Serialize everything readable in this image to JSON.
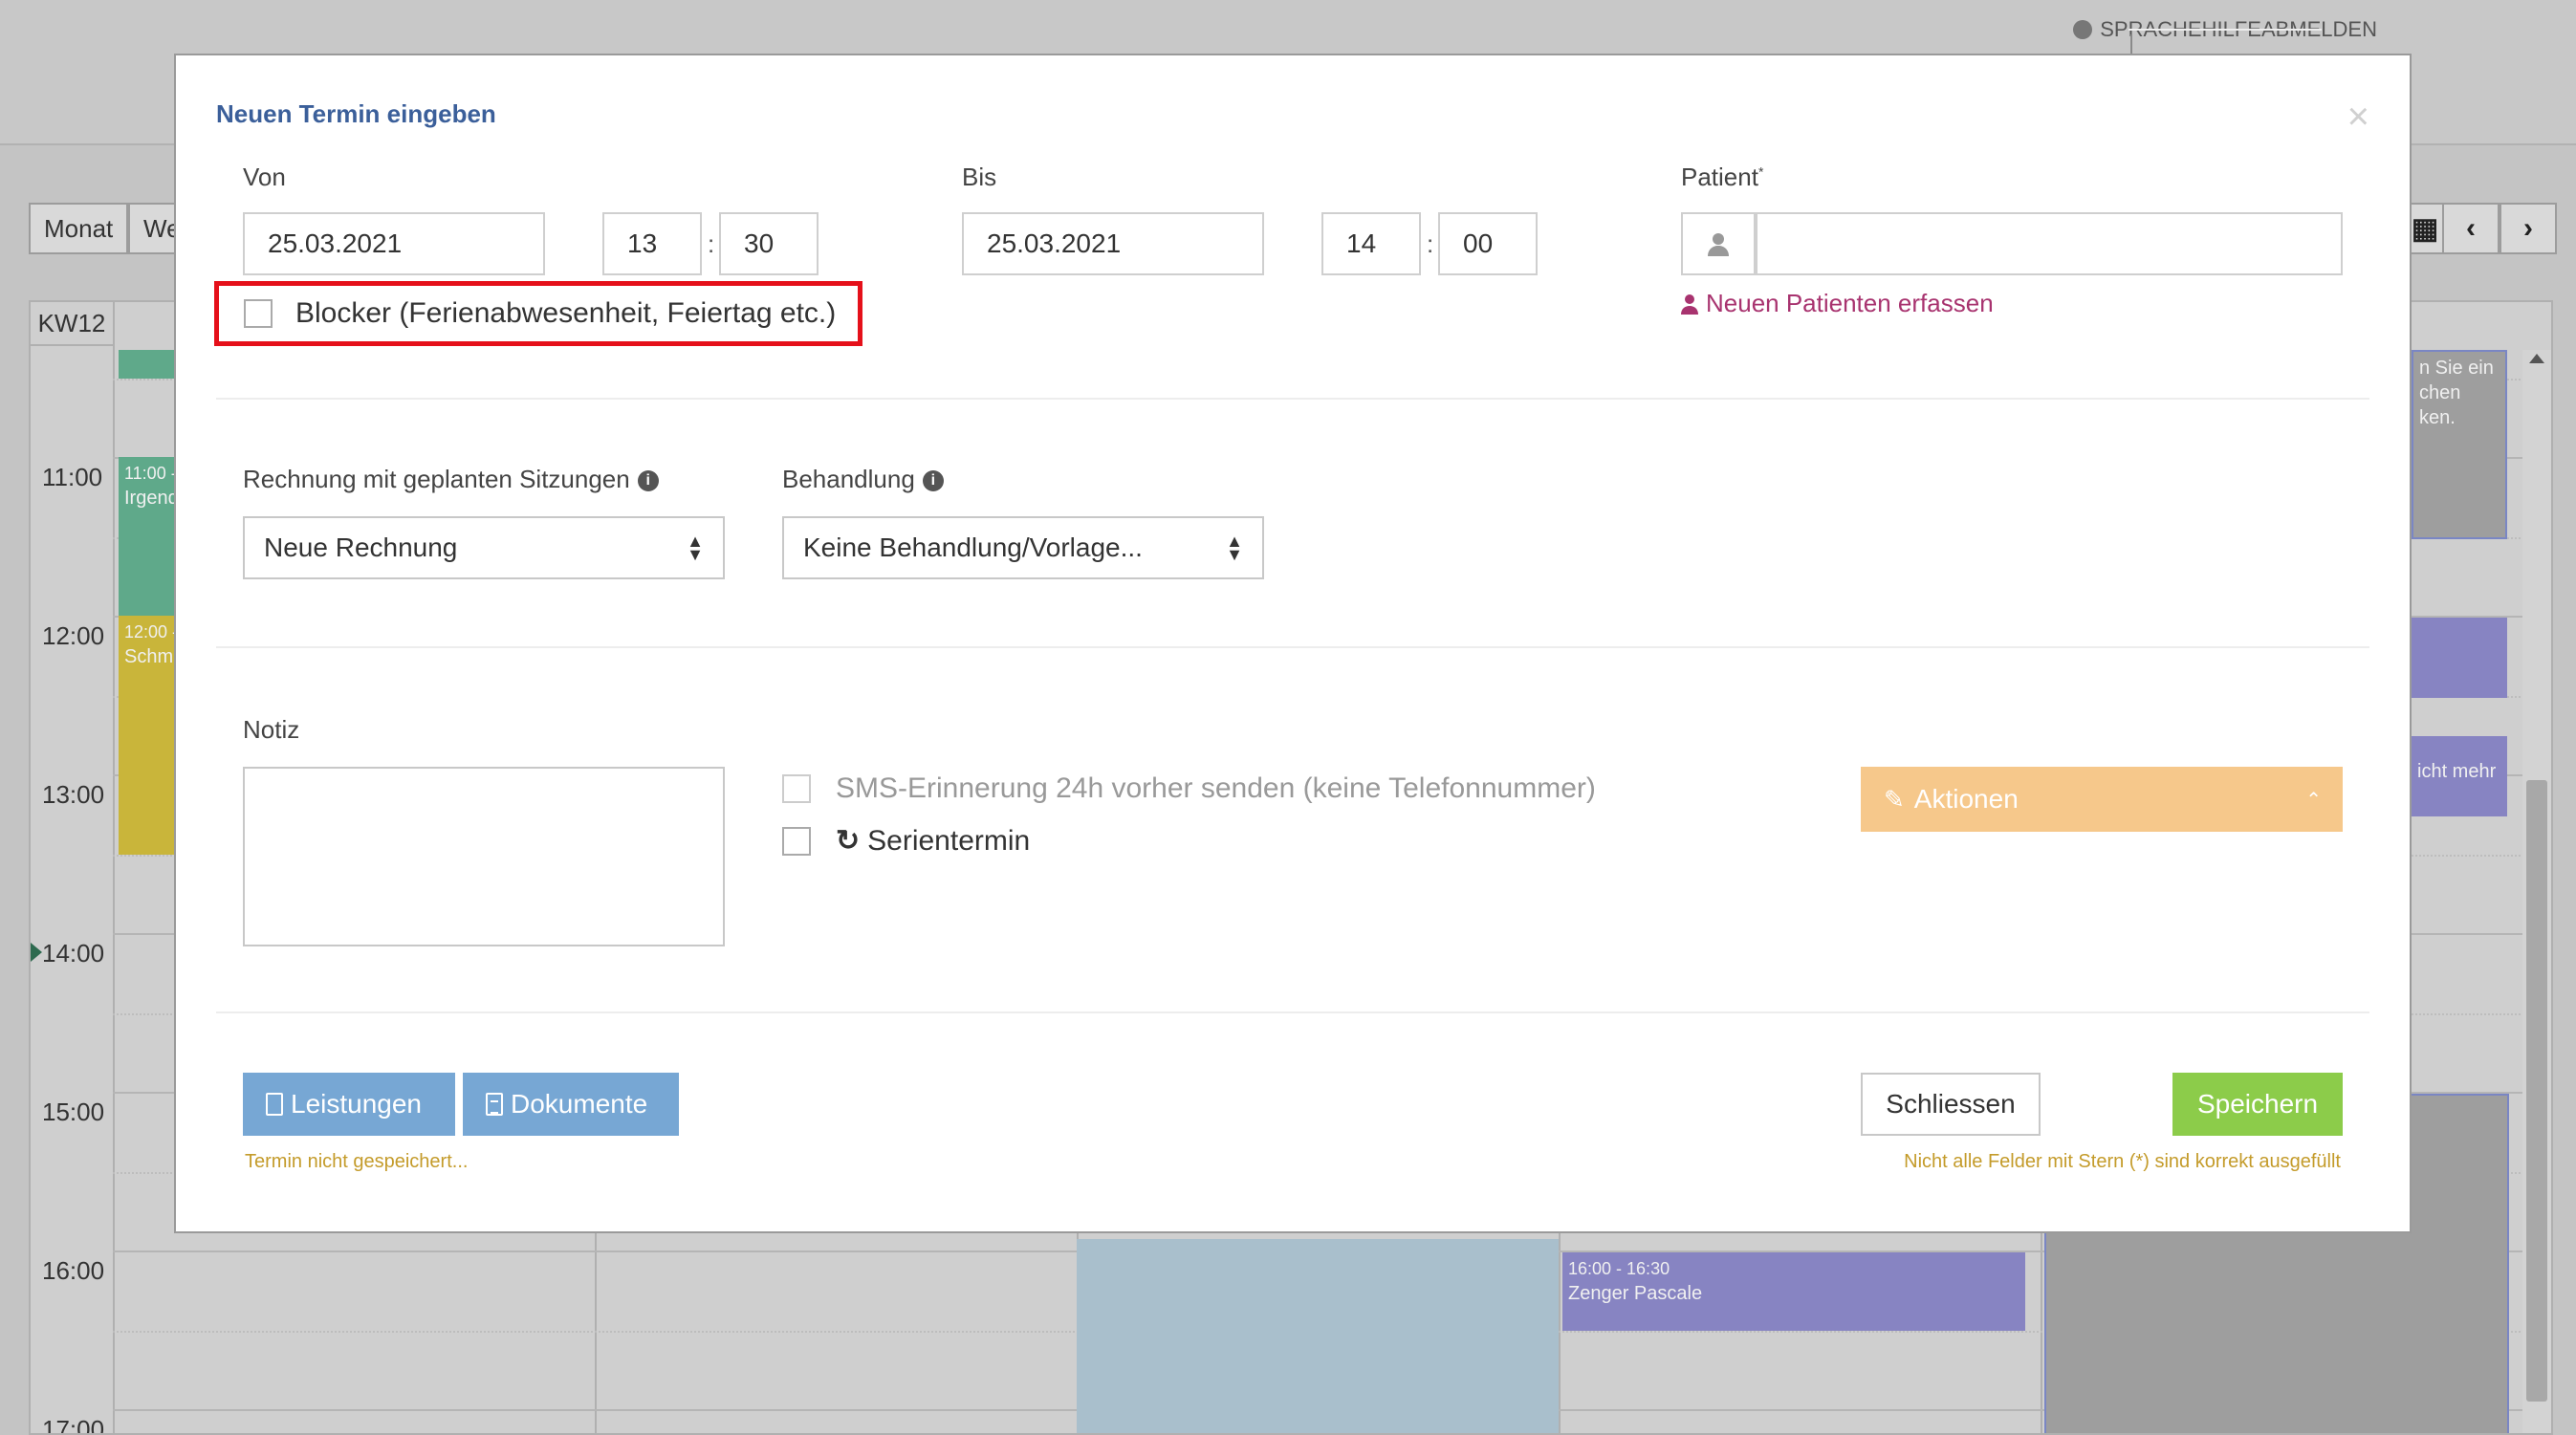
{
  "header": {
    "links": [
      "SPRACHE",
      "HILFE",
      "ABMELDEN"
    ]
  },
  "calendar": {
    "views": [
      "Monat",
      "We"
    ],
    "week": "KW12",
    "times": [
      "11:00",
      "12:00",
      "13:00",
      "14:00",
      "15:00",
      "16:00",
      "17:00"
    ],
    "events": [
      {
        "time": "11:00 -",
        "title": "Irgend"
      },
      {
        "time": "12:00 -",
        "title": "Schm"
      },
      {
        "time": "16:00 - 16:30",
        "title": "Zenger Pascale"
      }
    ],
    "side_texts": [
      "n Sie ein",
      "chen",
      "ken.",
      "icht mehr"
    ]
  },
  "modal": {
    "title": "Neuen Termin eingeben",
    "close": "×",
    "von": {
      "label": "Von",
      "date": "25.03.2021",
      "hour": "13",
      "minute": "30"
    },
    "bis": {
      "label": "Bis",
      "date": "25.03.2021",
      "hour": "14",
      "minute": "00"
    },
    "time_separator": ":",
    "patient": {
      "label": "Patient",
      "required_mark": "*",
      "value": "",
      "new_link": "Neuen Patienten erfassen"
    },
    "blocker_label": "Blocker (Ferienabwesenheit, Feiertag etc.)",
    "rechnung": {
      "label": "Rechnung mit geplanten Sitzungen",
      "value": "Neue Rechnung"
    },
    "behandlung": {
      "label": "Behandlung",
      "value": "Keine Behandlung/Vorlage..."
    },
    "notiz_label": "Notiz",
    "sms_label": "SMS-Erinnerung 24h vorher senden (keine Telefonnummer)",
    "serie_label": "Serientermin",
    "aktionen_label": "Aktionen",
    "leistungen_label": "Leistungen",
    "dokumente_label": "Dokumente",
    "schliessen_label": "Schliessen",
    "speichern_label": "Speichern",
    "status_left": "Termin nicht gespeichert...",
    "status_right": "Nicht alle Felder mit Stern (*) sind korrekt ausgefüllt"
  },
  "colors": {
    "accent_title": "#3b5f9a",
    "blocker_highlight": "#e5101a",
    "link_patient": "#a8336f",
    "button_blue": "#77a7d4",
    "button_green": "#8ccc4a",
    "aktionen": "#f6c88b",
    "hint": "#c49b2a"
  }
}
